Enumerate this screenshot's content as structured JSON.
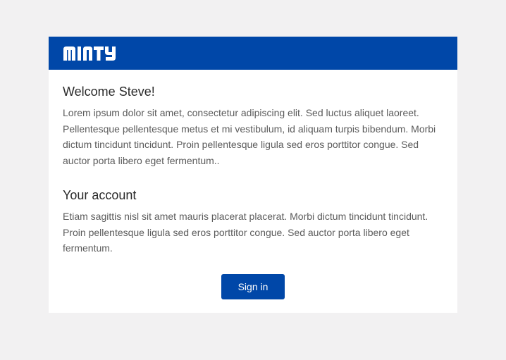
{
  "brand": {
    "logo_text": "MINTY",
    "color": "#0047a8"
  },
  "welcome": {
    "heading": "Welcome Steve!",
    "body": "Lorem ipsum dolor sit amet, consectetur adipiscing elit. Sed luctus aliquet laoreet. Pellentesque pellentesque metus et mi vestibulum, id aliquam turpis bibendum. Morbi dictum tincidunt tincidunt. Proin pellentesque ligula sed eros porttitor congue. Sed auctor porta libero eget fermentum.."
  },
  "account": {
    "heading": "Your account",
    "body": "Etiam sagittis nisl sit amet mauris placerat placerat. Morbi dictum tincidunt tincidunt. Proin pellentesque ligula sed eros porttitor congue. Sed auctor porta libero eget fermentum."
  },
  "actions": {
    "sign_in_label": "Sign in"
  }
}
